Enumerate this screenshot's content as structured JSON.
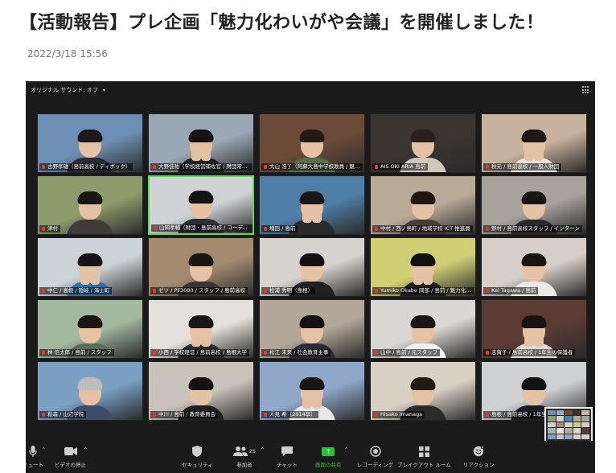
{
  "article": {
    "title": "【活動報告】プレ企画「魅力化わいがや会議」を開催しました！",
    "date": "2022/3/18 15:56"
  },
  "zoom": {
    "top_label": "オリジナル サウンド: オフ",
    "top_caret": "▾",
    "tiles": [
      {
        "label": "古野孝雄（島前高校 / ディボック）",
        "bg": "#6d8fb5",
        "shirt": "#2b2b33",
        "hair": "#1c1a18"
      },
      {
        "label": "大野佳祐（学校経営補佐官 / 財団常務理事）",
        "bg": "#9aa7b4",
        "shirt": "#1f1f26",
        "hair": "#161412"
      },
      {
        "label": "大山 浩了（阿蘇大島中学校教員 / 魅力化）",
        "bg": "#6b4a38",
        "shirt": "#5b6e4c",
        "hair": "#211a16"
      },
      {
        "label": "AIS OKI ARIA 島前",
        "bg": "#3a3530",
        "shirt": "#cfc8c0",
        "hair": "#2a201a"
      },
      {
        "label": "秋元 / 島前高校 / 一般人財団",
        "bg": "#c7b29d",
        "shirt": "#e9e4df",
        "hair": "#1e1713"
      },
      {
        "label": "津村",
        "bg": "#8d9c6a",
        "shirt": "#3f3b3a",
        "hair": "#1a1612"
      },
      {
        "label": "山岡孝輔（財団・島前高校 / コーディネーター）",
        "bg": "#cfd3d6",
        "shirt": "#2e2e38",
        "hair": "#141211",
        "active": true
      },
      {
        "label": "増田 / 島前",
        "bg": "#4f7fa8",
        "shirt": "#2a2a2a",
        "hair": "#1a1714"
      },
      {
        "label": "中村 / 西ノ島町 / 地域学校 ICT 推進員",
        "bg": "#b9aa98",
        "shirt": "#4b3a36",
        "hair": "#1d1612"
      },
      {
        "label": "野村 / 島前高校スタッフ / インターン",
        "bg": "#a7a29a",
        "shirt": "#2d2b29",
        "hair": "#171412"
      },
      {
        "label": "中仁 / 島根 / 隠岐 / 海士町",
        "bg": "#cdd4d8",
        "shirt": "#2f6fae",
        "hair": "#151313"
      },
      {
        "label": "ゼツ / PF3000 / スタッフ / 島前高校",
        "bg": "#a38a70",
        "shirt": "#3a3330",
        "hair": "#1a1613"
      },
      {
        "label": "松浦 秀明（島根）",
        "bg": "#d6d2cc",
        "shirt": "#202020",
        "hair": "#121010"
      },
      {
        "label": "Yumiko Okabe 岡部 / 島前 / 魅力化スタッフ",
        "bg": "#d0cf74",
        "shirt": "#1f1f22",
        "hair": "#131110"
      },
      {
        "label": "Kei Tagawa / 島前",
        "bg": "#d7cfc7",
        "shirt": "#efe9e4",
        "hair": "#1b1512"
      },
      {
        "label": "林 信太郎 / 島前 / スタッフ",
        "bg": "#a4b8a0",
        "shirt": "#5f6b5a",
        "hair": "#1b1613"
      },
      {
        "label": "小西 / 学校経営 / 島前高校 / 島根大学",
        "bg": "#e4e0db",
        "shirt": "#272727",
        "hair": "#181513"
      },
      {
        "label": "松江 未来 / 社会教育主事",
        "bg": "#b3a799",
        "shirt": "#2e2b36",
        "hair": "#151211"
      },
      {
        "label": "山中 / 島前 / 元スタッフ",
        "bg": "#d9d7d3",
        "shirt": "#f2f2f2",
        "hair": "#1c1714"
      },
      {
        "label": "志賀子 / 島前高校 / 1年生の保護者",
        "bg": "#5b3b34",
        "shirt": "#e4dcd6",
        "hair": "#171311"
      },
      {
        "label": "萩森 / 山辺学院",
        "bg": "#7aa0c4",
        "shirt": "#3d4c6a",
        "hair": "#bdbdbd"
      },
      {
        "label": "中川 / 島前 / 教育委員会",
        "bg": "#c9c3bb",
        "shirt": "#1e1e1e",
        "hair": "#141110"
      },
      {
        "label": "人見 希（2014卒）",
        "bg": "#8fa7c9",
        "shirt": "#e7e7e7",
        "hair": "#1a1512"
      },
      {
        "label": "Hisako Imanaga",
        "bg": "#d9d0c4",
        "shirt": "#2b2b2b",
        "hair": "#231a14"
      },
      {
        "label": "島根 / 島前高校 / 1年生",
        "bg": "#cfd0d2",
        "shirt": "#1b1b22",
        "hair": "#141212"
      }
    ],
    "toolbar": {
      "mute": "ミュート",
      "video": "ビデオの停止",
      "security": "セキュリティ",
      "participants": "参加者",
      "participants_count": "26",
      "chat": "チャット",
      "share": "画面の共有",
      "record": "レコーディング",
      "breakout": "ブレイクアウト ルーム",
      "reactions": "リアクション"
    },
    "icons": {
      "mic": "mic-icon",
      "video": "video-camera-icon",
      "security": "shield-icon",
      "participants": "people-icon",
      "chat": "chat-bubble-icon",
      "share": "share-screen-icon",
      "record": "record-icon",
      "breakout": "grid-icon",
      "reactions": "emoji-icon"
    },
    "colors": {
      "share_green": "#27c437",
      "active_speaker": "#5fd85f"
    }
  }
}
